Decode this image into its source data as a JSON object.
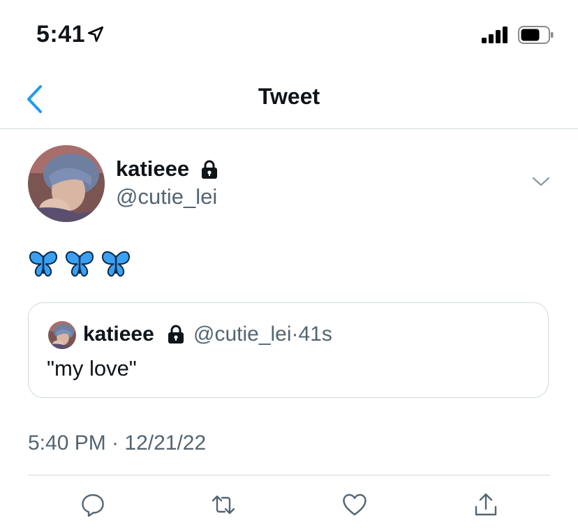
{
  "status_bar": {
    "time": "5:41"
  },
  "nav": {
    "title": "Tweet"
  },
  "tweet": {
    "author": {
      "display_name": "katieee",
      "handle": "@cutie_lei"
    },
    "emojis": [
      "butterfly",
      "butterfly",
      "butterfly"
    ],
    "quote": {
      "display_name": "katieee",
      "handle": "@cutie_lei",
      "separator": "·",
      "age": "41s",
      "text": "\"my love\""
    },
    "timestamp": "5:40 PM · 12/21/22"
  },
  "icons": {
    "back": "chevron-left-icon",
    "more": "chevron-down-icon",
    "reply": "reply-icon",
    "retweet": "retweet-icon",
    "like": "heart-icon",
    "share": "share-icon",
    "lock": "lock-icon"
  },
  "colors": {
    "accent": "#1d9bf0",
    "secondary_text": "#536471",
    "divider": "#cfd9de",
    "butterfly": "#3aa0f2"
  }
}
